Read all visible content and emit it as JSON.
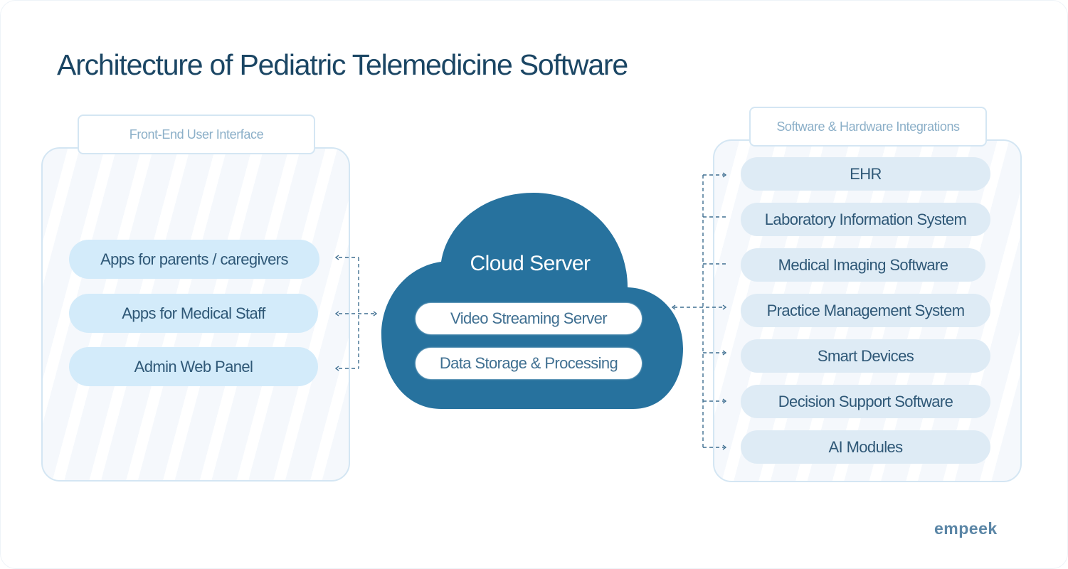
{
  "title": "Architecture of Pediatric Telemedicine Software",
  "front_end": {
    "label": "Front-End User Interface",
    "items": [
      {
        "label": "Apps for parents / caregivers"
      },
      {
        "label": "Apps for Medical Staff"
      },
      {
        "label": "Admin Web Panel"
      }
    ]
  },
  "cloud": {
    "title": "Cloud Server",
    "components": [
      {
        "label": "Video Streaming Server"
      },
      {
        "label": "Data Storage & Processing"
      }
    ],
    "color": "#27729e"
  },
  "integrations": {
    "label": "Software & Hardware Integrations",
    "items": [
      {
        "label": "EHR"
      },
      {
        "label": "Laboratory Information System"
      },
      {
        "label": "Medical Imaging Software"
      },
      {
        "label": "Practice Management System"
      },
      {
        "label": "Smart Devices"
      },
      {
        "label": "Decision Support Software"
      },
      {
        "label": "AI Modules"
      }
    ]
  },
  "connections": [
    {
      "from": "Cloud Server",
      "to": "Apps for parents / caregivers",
      "style": "dashed-arrow"
    },
    {
      "from": "Cloud Server",
      "to": "Apps for Medical Staff",
      "style": "dashed-bidirectional"
    },
    {
      "from": "Cloud Server",
      "to": "Admin Web Panel",
      "style": "dashed-arrow"
    },
    {
      "from": "Cloud Server",
      "to": "EHR",
      "style": "dashed-arrow"
    },
    {
      "from": "Cloud Server",
      "to": "Laboratory Information System",
      "style": "dashed-line"
    },
    {
      "from": "Cloud Server",
      "to": "Medical Imaging Software",
      "style": "dashed-line"
    },
    {
      "from": "Cloud Server",
      "to": "Practice Management System",
      "style": "dashed-bidirectional"
    },
    {
      "from": "Cloud Server",
      "to": "Smart Devices",
      "style": "dashed-arrow"
    },
    {
      "from": "Cloud Server",
      "to": "Decision Support Software",
      "style": "dashed-arrow"
    },
    {
      "from": "Cloud Server",
      "to": "AI Modules",
      "style": "dashed-arrow"
    }
  ],
  "brand": "empeek"
}
